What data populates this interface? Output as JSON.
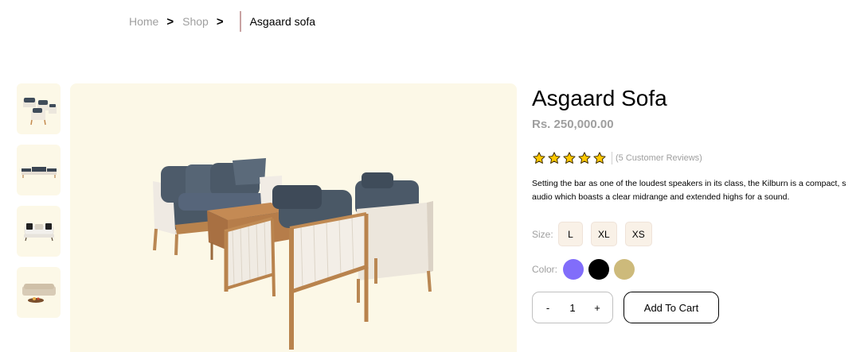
{
  "breadcrumb": {
    "home": "Home",
    "shop": "Shop",
    "separator": ">",
    "current": "Asgaard sofa"
  },
  "thumbnails": [
    {
      "alt": "sofa-set-angle"
    },
    {
      "alt": "sofa-set-front"
    },
    {
      "alt": "sofa-white"
    },
    {
      "alt": "sofa-beige-living"
    }
  ],
  "product": {
    "title": "Asgaard Sofa",
    "price": "Rs. 250,000.00",
    "rating": 5,
    "reviews": "(5 Customer Reviews)",
    "description_line1": "Setting the bar as one of the loudest speakers in its class, the Kilburn is a compact, s",
    "description_line2": "audio which boasts a clear midrange and extended highs for a sound."
  },
  "size": {
    "label": "Size:",
    "options": [
      "L",
      "XL",
      "XS"
    ]
  },
  "color": {
    "label": "Color:",
    "options": [
      "#816dfa",
      "#000000",
      "#cdba7b"
    ]
  },
  "cart": {
    "minus": "-",
    "quantity": "1",
    "plus": "+",
    "add_label": "Add To Cart"
  },
  "colors": {
    "image_bg": "#fcf8e7",
    "star": "#ffc700",
    "muted_text": "#9f9f9f"
  }
}
